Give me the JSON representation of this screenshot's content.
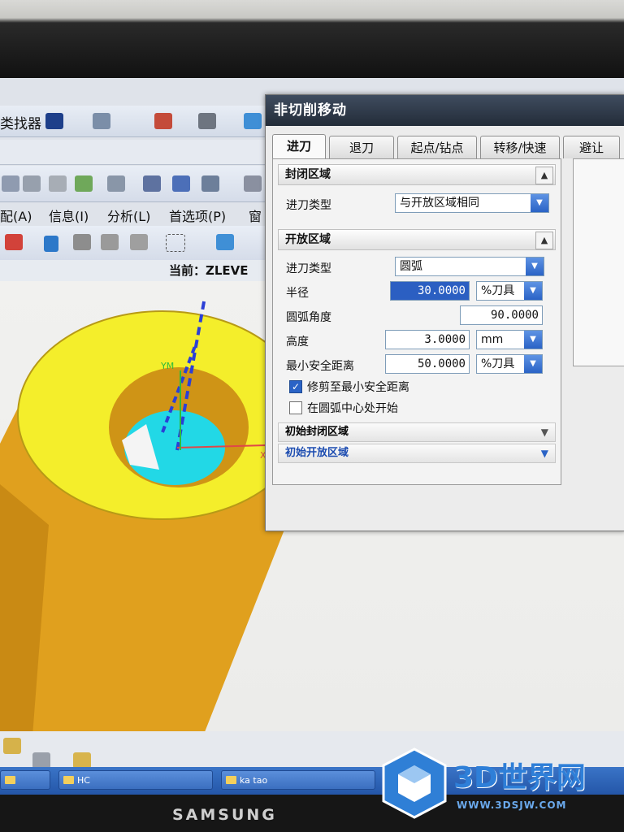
{
  "monitor": {
    "brand": "SAMSUNG"
  },
  "main_window": {
    "toolbar_finder": "类找器",
    "menu": [
      "配(A)",
      "信息(I)",
      "分析(L)",
      "首选项(P)",
      "窗"
    ],
    "current_view": "当前：ZLEVE"
  },
  "viewport": {
    "axis_y": "YM",
    "axis_x": "X"
  },
  "dialog": {
    "title": "非切削移动",
    "tabs": [
      "进刀",
      "退刀",
      "起点/钻点",
      "转移/快速",
      "避让"
    ],
    "active_tab": "进刀",
    "closed_region": {
      "header": "封闭区域",
      "engage_type_label": "进刀类型",
      "engage_type_value": "与开放区域相同"
    },
    "open_region": {
      "header": "开放区域",
      "engage_type_label": "进刀类型",
      "engage_type_value": "圆弧",
      "radius_label": "半径",
      "radius_value": "30.0000",
      "radius_unit": "%刀具",
      "arc_angle_label": "圆弧角度",
      "arc_angle_value": "90.0000",
      "height_label": "高度",
      "height_value": "3.0000",
      "height_unit": "mm",
      "min_clearance_label": "最小安全距离",
      "min_clearance_value": "50.0000",
      "min_clearance_unit": "%刀具",
      "trim_label": "修剪至最小安全距离",
      "trim_checked": true,
      "arc_center_label": "在圆弧中心处开始",
      "arc_center_checked": false
    },
    "initial_closed_region": "初始封闭区域",
    "initial_open_region": "初始开放区域"
  },
  "taskbar": {
    "items": [
      "",
      "HC",
      "ka tao",
      "3D世"
    ]
  },
  "watermark": {
    "text": "3D世界网",
    "url": "WWW.3DSJW.COM"
  }
}
